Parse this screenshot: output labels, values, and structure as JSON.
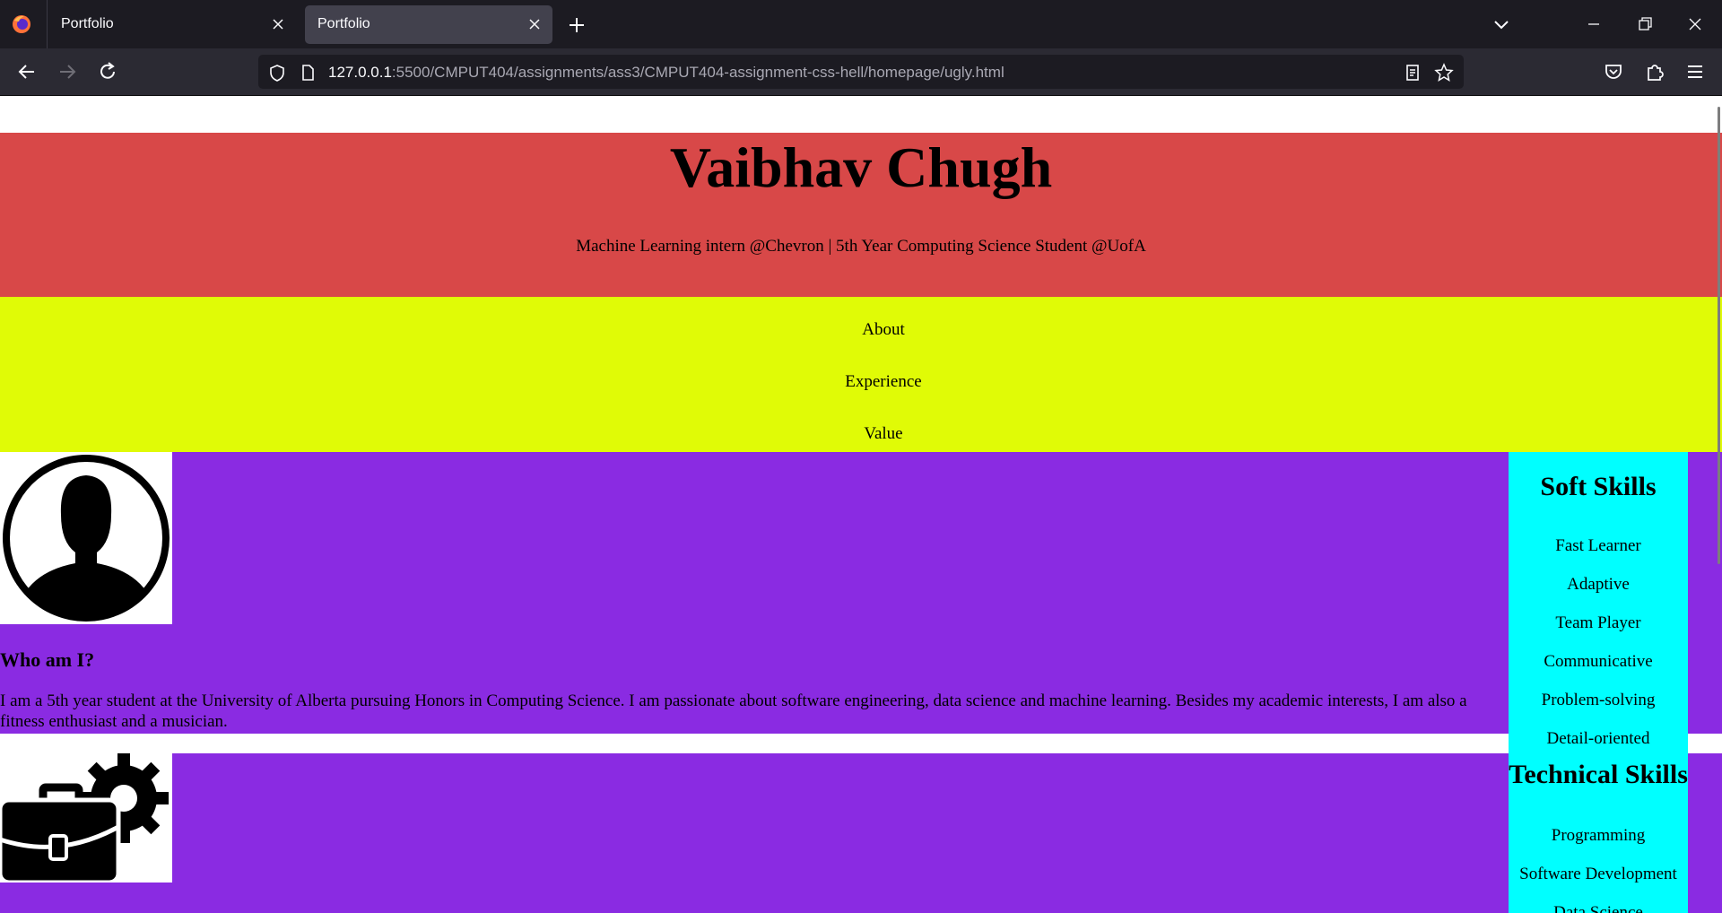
{
  "browser": {
    "tabs": [
      {
        "title": "Portfolio",
        "active": false
      },
      {
        "title": "Portfolio",
        "active": true
      }
    ],
    "url_host": "127.0.0.1",
    "url_rest": ":5500/CMPUT404/assignments/ass3/CMPUT404-assignment-css-hell/homepage/ugly.html"
  },
  "header": {
    "name": "Vaibhav Chugh",
    "tagline": "Machine Learning intern @Chevron | 5th Year Computing Science Student @UofA"
  },
  "menu": {
    "items": [
      "About",
      "Experience",
      "Value"
    ]
  },
  "about": {
    "title": "Who am I?",
    "text": "I am a 5th year student at the University of Alberta pursuing Honors in Computing Science. I am passionate about software engineering, data science and machine learning. Besides my academic interests, I am also a fitness enthusiast and a musician."
  },
  "skills": {
    "soft_title": "Soft Skills",
    "soft": [
      "Fast Learner",
      "Adaptive",
      "Team Player",
      "Communicative",
      "Problem-solving",
      "Detail-oriented"
    ],
    "tech_title": "Technical Skills",
    "tech": [
      "Programming",
      "Software Development",
      "Data Science"
    ]
  },
  "colors": {
    "header_bg": "#d84848",
    "menu_bg": "#e0fb06",
    "panel_bg": "#8a2be2",
    "skills_bg": "#00ffff"
  }
}
